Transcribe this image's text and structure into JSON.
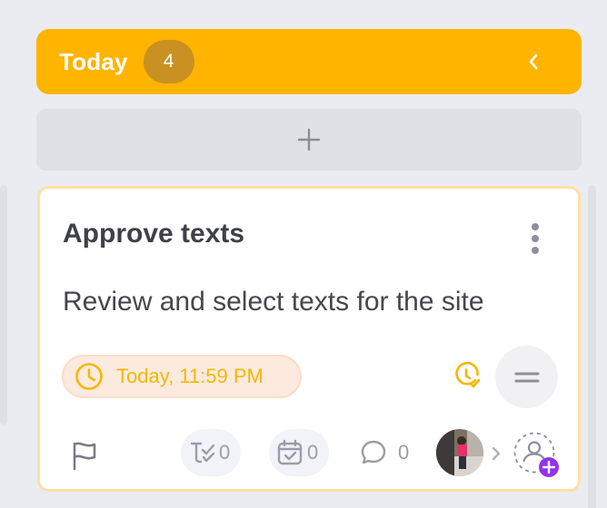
{
  "column": {
    "title": "Today",
    "count": "4",
    "collapse_icon": "chevron-left-icon",
    "add_icon": "plus-icon",
    "accent": "#ffb400"
  },
  "card": {
    "title": "Approve texts",
    "description": "Review and select texts for the site",
    "menu_icon": "more-vertical-icon",
    "due": {
      "label": "Today, 11:59 PM",
      "icon": "clock-icon",
      "color": "#f5b800"
    },
    "time_track_icon": "clock-check-icon",
    "priority_icon": "priority-medium-icon",
    "flag_icon": "flag-icon",
    "stats": {
      "subtasks": "0",
      "checklists": "0",
      "comments": "0"
    },
    "assignee_icon": "add-user-icon"
  }
}
